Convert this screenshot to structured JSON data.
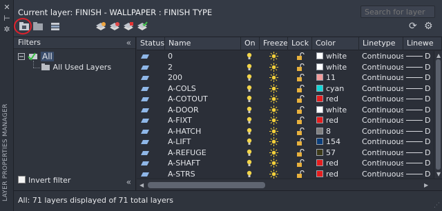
{
  "palette": {
    "vertical_title": "LAYER PROPERTIES MANAGER",
    "close_glyph": "✕",
    "autohide_glyph": "⊢",
    "settings_glyph": "✲"
  },
  "header": {
    "current_layer": "Current layer: FINISH - WALLPAPER : FINISH TYPE",
    "search_placeholder": "Search for layer",
    "refresh_glyph": "⟳",
    "settings_glyph": "⚙",
    "toolbar_icons": [
      "new-property-filter-icon",
      "new-group-filter-icon",
      "layer-states-manager-icon",
      "new-layer-icon",
      "new-layer-vp-frozen-icon",
      "delete-layer-icon",
      "set-current-icon"
    ]
  },
  "filters": {
    "title": "Filters",
    "collapse_glyph": "«",
    "tree": [
      {
        "label": "All",
        "level": 0
      },
      {
        "label": "All Used Layers",
        "level": 1
      }
    ],
    "invert_filter_label": "Invert filter"
  },
  "table": {
    "columns": [
      "Status",
      "Name",
      "On",
      "Freeze",
      "Lock",
      "Color",
      "Linetype",
      "Linewe"
    ],
    "rows": [
      {
        "name": "0",
        "color_name": "white",
        "color_hex": "#ffffff",
        "linetype": "Continuous",
        "lineweight": "D"
      },
      {
        "name": "2",
        "color_name": "white",
        "color_hex": "#ffffff",
        "linetype": "Continuous",
        "lineweight": "D"
      },
      {
        "name": "200",
        "color_name": "11",
        "color_hex": "#f39b9b",
        "linetype": "Continuous",
        "lineweight": "D"
      },
      {
        "name": "A-COLS",
        "color_name": "cyan",
        "color_hex": "#12d7d7",
        "linetype": "Continuous",
        "lineweight": "D"
      },
      {
        "name": "A-COTOUT",
        "color_name": "red",
        "color_hex": "#e51d1d",
        "linetype": "Continuous",
        "lineweight": "D"
      },
      {
        "name": "A-DOOR",
        "color_name": "white",
        "color_hex": "#ffffff",
        "linetype": "Continuous",
        "lineweight": "D"
      },
      {
        "name": "A-FIXT",
        "color_name": "red",
        "color_hex": "#e51d1d",
        "linetype": "Continuous",
        "lineweight": "D"
      },
      {
        "name": "A-HATCH",
        "color_name": "8",
        "color_hex": "#808080",
        "linetype": "Continuous",
        "lineweight": "D"
      },
      {
        "name": "A-LIFT",
        "color_name": "154",
        "color_hex": "#0b3e7a",
        "linetype": "Continuous",
        "lineweight": "D"
      },
      {
        "name": "A-REFUGE",
        "color_name": "57",
        "color_hex": "#3c3a1a",
        "linetype": "Continuous",
        "lineweight": "D"
      },
      {
        "name": "A-SHAFT",
        "color_name": "red",
        "color_hex": "#e51d1d",
        "linetype": "Continuous",
        "lineweight": "D"
      },
      {
        "name": "A-STRS",
        "color_name": "red",
        "color_hex": "#e51d1d",
        "linetype": "Continuous",
        "lineweight": "D"
      }
    ]
  },
  "status": {
    "text": "All: 71 layers displayed of 71 total layers"
  },
  "colors": {
    "highlight_circle": "#e0212b",
    "bulb": "#f2d54a",
    "sun": "#f2cf3a",
    "lock": "#e8b13d",
    "status_icon": "#8fb7e8"
  }
}
